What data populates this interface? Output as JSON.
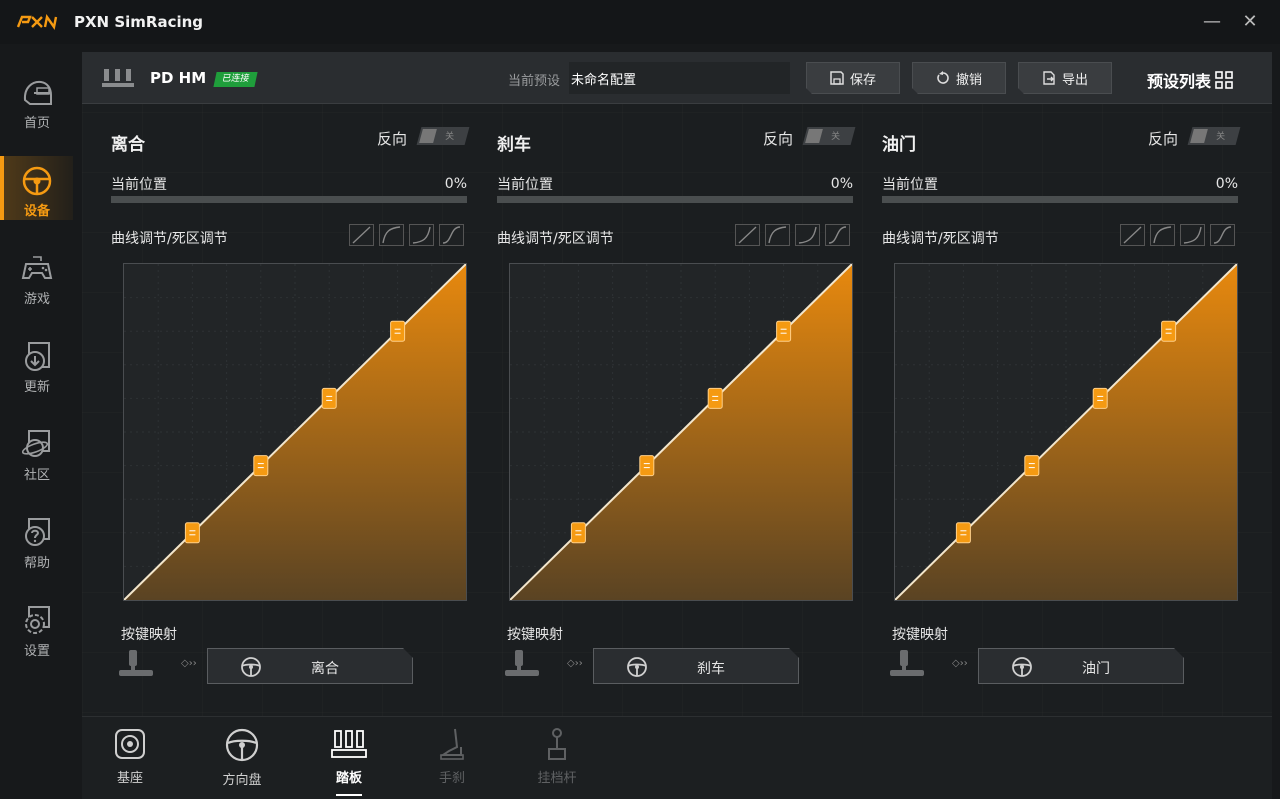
{
  "window": {
    "title": "PXN SimRacing",
    "logo_text": "PXN",
    "minimize": "—",
    "close": "✕"
  },
  "sidebar": {
    "items": [
      {
        "label": "首页",
        "icon": "helmet-icon"
      },
      {
        "label": "设备",
        "icon": "steering-wheel-icon",
        "active": true
      },
      {
        "label": "游戏",
        "icon": "gamepad-icon"
      },
      {
        "label": "更新",
        "icon": "update-icon"
      },
      {
        "label": "社区",
        "icon": "planet-icon"
      },
      {
        "label": "帮助",
        "icon": "help-icon"
      },
      {
        "label": "设置",
        "icon": "gear-icon"
      }
    ]
  },
  "header": {
    "device_name": "PD HM",
    "status_badge": "已连接",
    "preset_label": "当前预设",
    "preset_value": "未命名配置",
    "save": "保存",
    "undo": "撤销",
    "export": "导出",
    "preset_list": "预设列表"
  },
  "pedals": [
    {
      "title": "离合",
      "reverse_label": "反向",
      "reverse_state": "关",
      "position_label": "当前位置",
      "position_value": "0%",
      "position_fraction": 0,
      "curve_label": "曲线调节/死区调节",
      "mapping_label": "按键映射",
      "mapping_button": "离合"
    },
    {
      "title": "刹车",
      "reverse_label": "反向",
      "reverse_state": "关",
      "position_label": "当前位置",
      "position_value": "0%",
      "position_fraction": 0,
      "curve_label": "曲线调节/死区调节",
      "mapping_label": "按键映射",
      "mapping_button": "刹车"
    },
    {
      "title": "油门",
      "reverse_label": "反向",
      "reverse_state": "关",
      "position_label": "当前位置",
      "position_value": "0%",
      "position_fraction": 0,
      "curve_label": "曲线调节/死区调节",
      "mapping_label": "按键映射",
      "mapping_button": "油门"
    }
  ],
  "curve_points": [
    [
      20,
      20
    ],
    [
      40,
      40
    ],
    [
      60,
      60
    ],
    [
      80,
      80
    ]
  ],
  "bottom_tabs": [
    {
      "label": "基座",
      "icon": "base-icon",
      "state": "normal"
    },
    {
      "label": "方向盘",
      "icon": "steering-wheel-icon",
      "state": "normal"
    },
    {
      "label": "踏板",
      "icon": "pedals-icon",
      "state": "active"
    },
    {
      "label": "手刹",
      "icon": "handbrake-icon",
      "state": "disabled"
    },
    {
      "label": "挂档杆",
      "icon": "shifter-icon",
      "state": "disabled"
    }
  ],
  "colors": {
    "accent": "#f59a12",
    "connected": "#1f9e3b",
    "background": "#17191b",
    "panel": "#2a2d30"
  }
}
